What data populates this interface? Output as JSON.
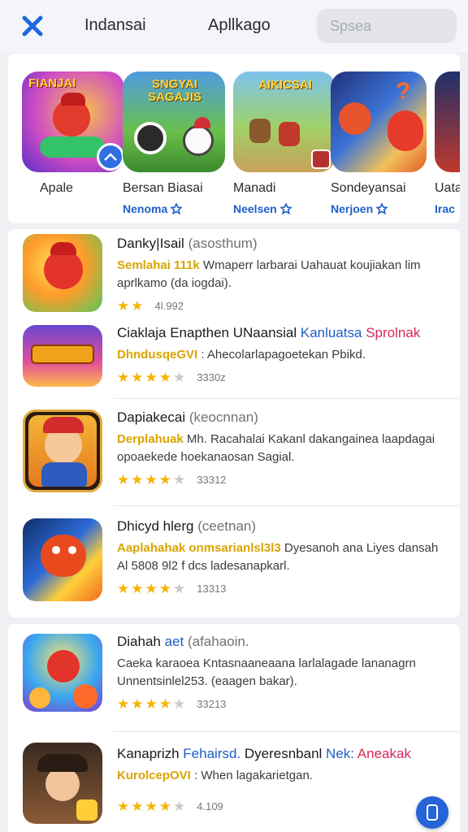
{
  "header": {
    "close_icon": "close-x-icon",
    "tabs": [
      {
        "label": "Indansai"
      },
      {
        "label": "Apllkago"
      }
    ],
    "search": {
      "placeholder": "Spsea"
    }
  },
  "featured": [
    {
      "name": "Apale",
      "tag": "",
      "art_text": "FIANJAI"
    },
    {
      "name": "Bеrsan Biasai",
      "tag": "Nenoma",
      "art_text": "SNGYAI SAGAJIS"
    },
    {
      "name": "Manadi",
      "tag": "Neelsen",
      "art_text": "AIKICSAI"
    },
    {
      "name": "Sondeyansai",
      "tag": "Nerjoen",
      "art_text": ""
    },
    {
      "name": "Uata",
      "tag": "Irac",
      "art_text": ""
    }
  ],
  "list_group_1": [
    {
      "title": "Danky|Isail",
      "subtitle": "(asosthum)",
      "desc_parts": [
        {
          "text": "Semlahai 111k",
          "style": "gold"
        },
        {
          "text": " Wmaperr larbarai Uahauat koujiakan lim aprlkamo (da iogdai).",
          "style": ""
        }
      ],
      "stars": 2,
      "count": "4l.992"
    },
    {
      "title": "Ciaklaja Enapthen UNaansial",
      "title_extra": [
        {
          "text": " Kanluatsa",
          "style": "blue"
        },
        {
          "text": " Sprolnak",
          "style": "red"
        }
      ],
      "desc_parts": [
        {
          "text": "DhndusqeGVI",
          "style": "gold"
        },
        {
          "text": " : Ahecolarlapagoetekan Pbikd.",
          "style": ""
        }
      ],
      "stars": 4,
      "count": "3330z"
    },
    {
      "title": "Dapiakecai",
      "subtitle": "(keocnnan)",
      "desc_parts": [
        {
          "text": "Derplahuak",
          "style": "gold"
        },
        {
          "text": " Mh. Racahalai Kakanl dakangainea laapdagai opoaekede hoekanaosan Sagial.",
          "style": ""
        }
      ],
      "stars": 4,
      "count": "33312"
    },
    {
      "title": "Dhicyd hlerg",
      "subtitle": "(ceetnan)",
      "desc_parts": [
        {
          "text": "Aaplahahak onmsarianlsl3l3",
          "style": "gold"
        },
        {
          "text": " Dyesanoh ana Liyes dansah Al 5808 9l2 f dcs ladesanapkarl.",
          "style": ""
        }
      ],
      "stars": 4,
      "count": "13313"
    }
  ],
  "list_group_2": [
    {
      "title": "Diahah",
      "title_extra": [
        {
          "text": " aet",
          "style": "blue"
        }
      ],
      "subtitle": "(afahaoin.",
      "desc_parts": [
        {
          "text": "Caeka karaoea Kntasnaaneaana larlalagade lananagrn Unnentsinlel253. (eaagen bakar).",
          "style": ""
        }
      ],
      "stars": 4,
      "count": "33213"
    },
    {
      "title": "Kanaprizh",
      "title_extra": [
        {
          "text": " Fehairsd.",
          "style": "blue"
        },
        {
          "text": " Dyeresnbanl",
          "style": ""
        },
        {
          "text": " Nek:",
          "style": "blue"
        },
        {
          "text": " Aneakak",
          "style": "red"
        }
      ],
      "desc_parts": [
        {
          "text": "KurolcepOVI",
          "style": "gold"
        },
        {
          "text": " : When lagakarietgan.",
          "style": ""
        }
      ],
      "stars": 4,
      "count": "4.109"
    }
  ],
  "fab": {
    "icon": "phone-icon"
  },
  "colors": {
    "accent": "#1e5ec8",
    "star": "#f5b400",
    "close": "#1f66e0"
  }
}
